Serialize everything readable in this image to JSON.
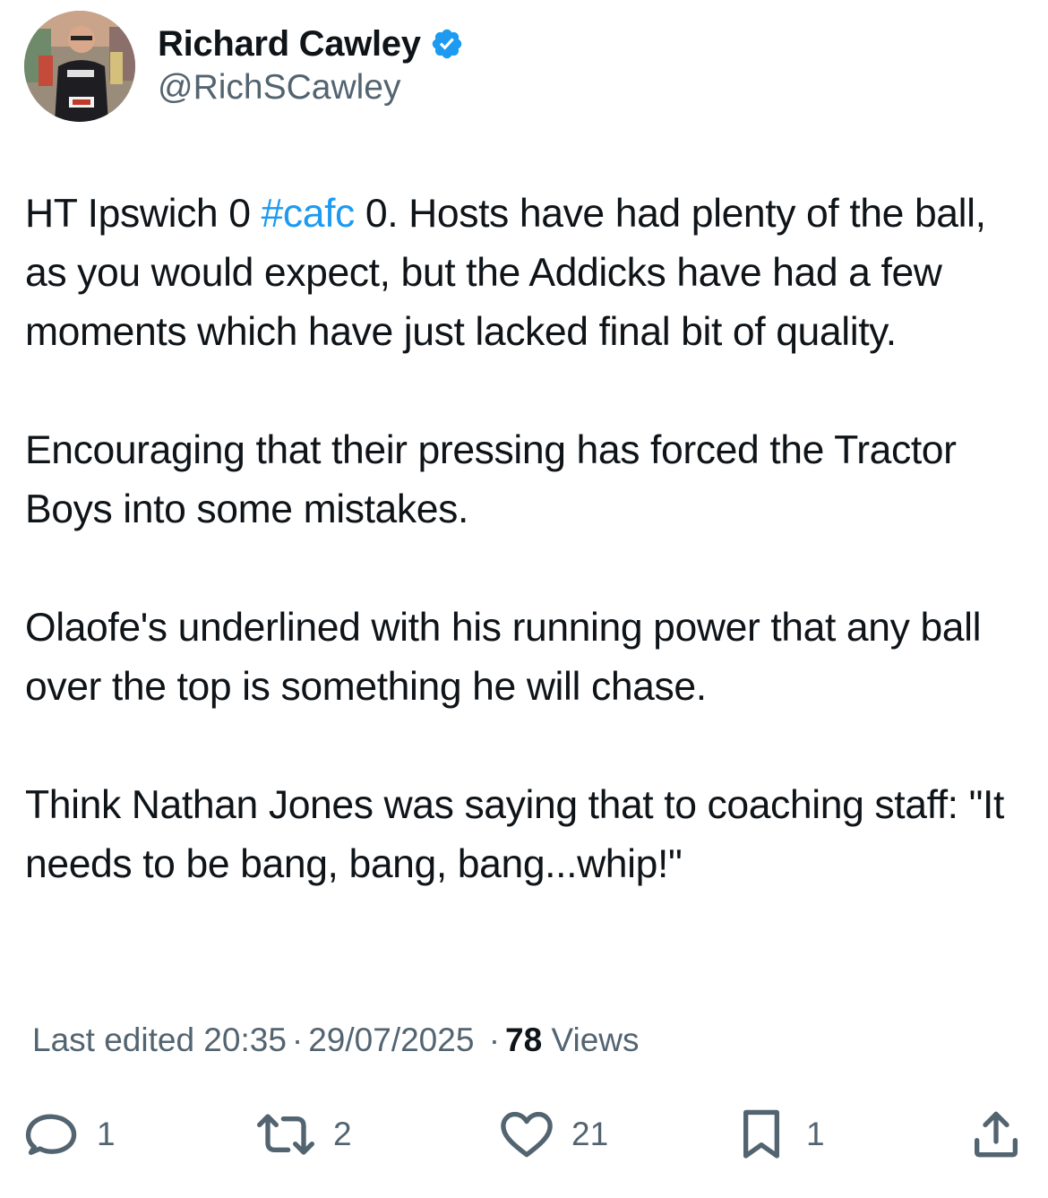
{
  "author": {
    "display_name": "Richard Cawley",
    "handle": "@RichSCawley",
    "avatar_icon": "profile-photo-runner",
    "verified_icon": "verified-badge-icon",
    "verified_color": "#1d9bf0"
  },
  "tweet": {
    "line1_prefix": "HT Ipswich 0 ",
    "hashtag": "#cafc",
    "line1_suffix": " 0. Hosts have had plenty of the ball, as you would expect, but the Addicks have had a few moments which have just lacked final bit of quality.",
    "para2": "Encouraging that their pressing has forced the Tractor Boys into some mistakes.",
    "para3": "Olaofe's underlined with his running power that any ball over the top is something he will chase.",
    "para4": "Think Nathan Jones was saying that to coaching staff: \"It needs to be bang, bang, bang...whip!\"",
    "hashtag_color": "#1d9bf0"
  },
  "meta": {
    "edited_label": "Last edited 20:35",
    "separator": "·",
    "date": "29/07/2025",
    "views_count": "78",
    "views_label": "Views"
  },
  "actions": {
    "reply": {
      "icon": "reply-icon",
      "count": "1"
    },
    "retweet": {
      "icon": "retweet-icon",
      "count": "2"
    },
    "like": {
      "icon": "heart-icon",
      "count": "21"
    },
    "bookmark": {
      "icon": "bookmark-icon",
      "count": "1"
    },
    "share": {
      "icon": "share-icon"
    }
  },
  "colors": {
    "text_primary": "#0f1419",
    "text_secondary": "#536471",
    "accent": "#1d9bf0"
  }
}
